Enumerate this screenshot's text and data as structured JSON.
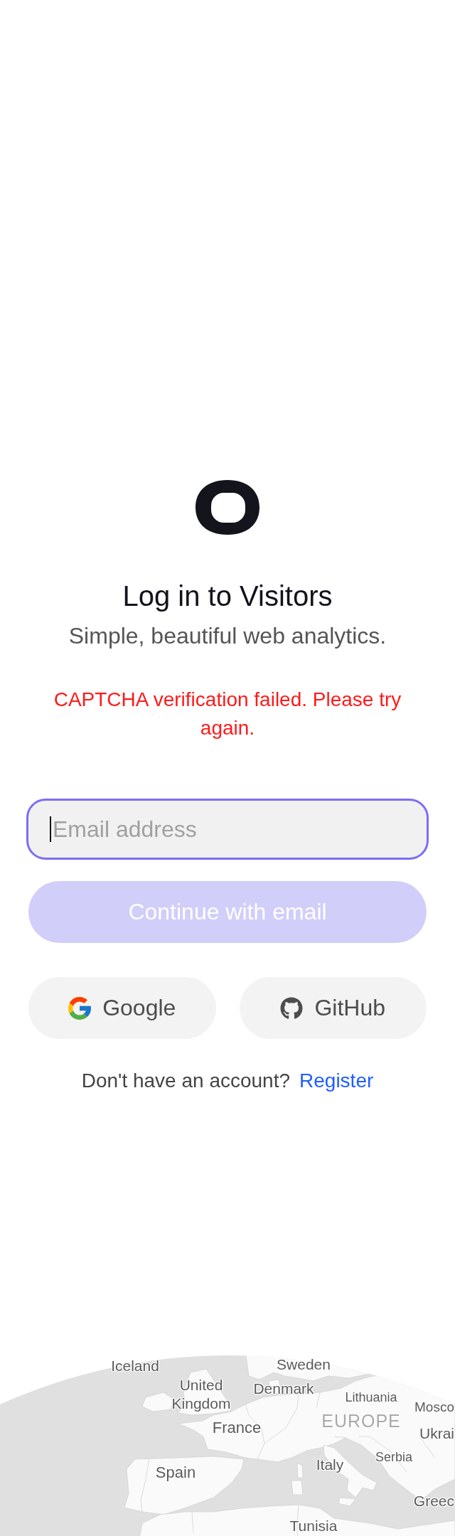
{
  "heading": {
    "title": "Log in to Visitors",
    "subtitle": "Simple, beautiful web analytics."
  },
  "error": "CAPTCHA verification failed. Please try again.",
  "email_field": {
    "placeholder": "Email address",
    "focused": true
  },
  "submit_button": {
    "label": "Continue with email",
    "disabled": true
  },
  "social_buttons": [
    {
      "label": "Google",
      "kind": "google"
    },
    {
      "label": "GitHub",
      "kind": "github"
    }
  ],
  "register_prompt": {
    "text": "Don't have an account?",
    "link": "Register"
  },
  "map": {
    "labels": [
      {
        "text": "Iceland",
        "kind": "country"
      },
      {
        "text": "Sweden",
        "kind": "country"
      },
      {
        "text": "United Kingdom",
        "kind": "country"
      },
      {
        "text": "Denmark",
        "kind": "country"
      },
      {
        "text": "Lithuania",
        "kind": "country"
      },
      {
        "text": "Mosco",
        "kind": "city"
      },
      {
        "text": "EUROPE",
        "kind": "region"
      },
      {
        "text": "France",
        "kind": "country"
      },
      {
        "text": "Ukrai",
        "kind": "country"
      },
      {
        "text": "Serbia",
        "kind": "country"
      },
      {
        "text": "Italy",
        "kind": "country"
      },
      {
        "text": "Spain",
        "kind": "country"
      },
      {
        "text": "Greec",
        "kind": "country"
      },
      {
        "text": "Tunisia",
        "kind": "country"
      }
    ]
  }
}
